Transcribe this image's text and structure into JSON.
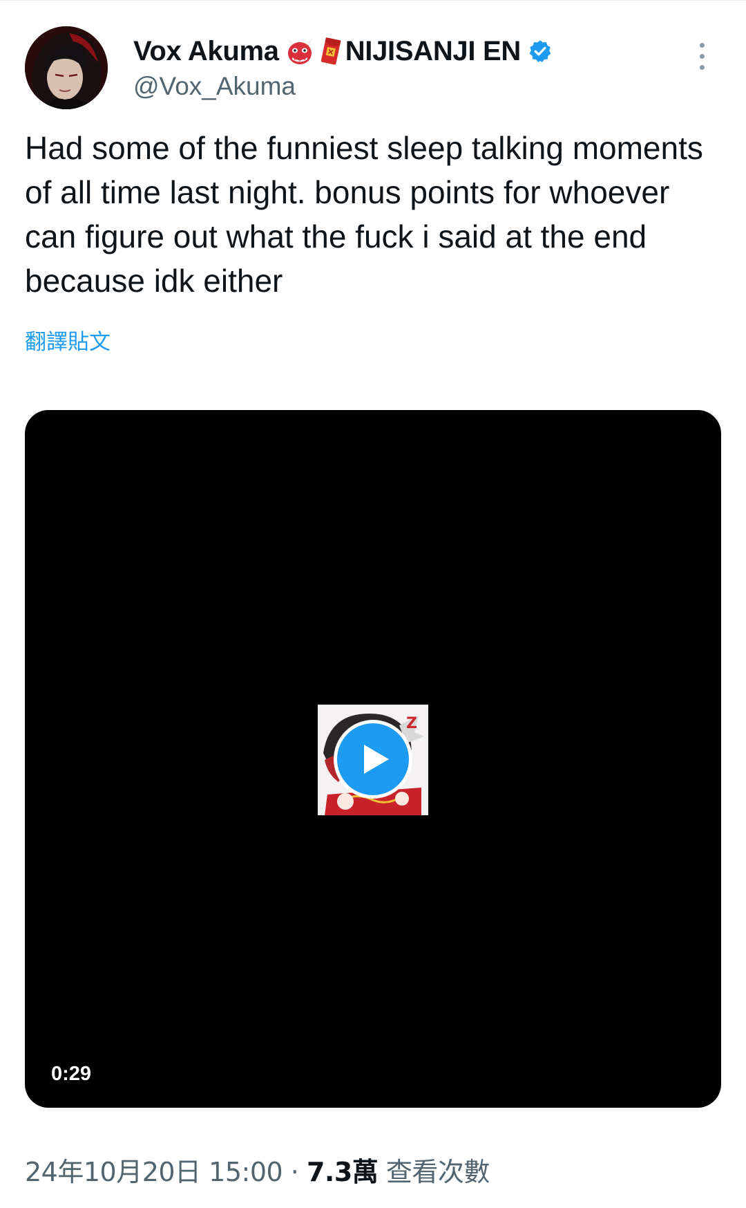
{
  "author": {
    "display_name": "Vox Akuma",
    "display_suffix": "NIJISANJI EN",
    "emojis": [
      "ogre-emoji",
      "red-envelope-emoji"
    ],
    "handle": "@Vox_Akuma",
    "verified": true
  },
  "tweet": {
    "text": "Had some of the funniest sleep talking moments of all time last night. bonus points for whoever can figure out what the fuck i said at the end because idk either",
    "translate_label": "翻譯貼文"
  },
  "video": {
    "duration": "0:29",
    "play_icon": "play-icon"
  },
  "meta": {
    "date": "24年10月20日",
    "time": "15:00",
    "separator": "·",
    "views_count": "7.3萬",
    "views_label": "查看次數"
  },
  "colors": {
    "link": "#1d9bf0",
    "secondary_text": "#536471",
    "verified": "#1d9bf0"
  }
}
